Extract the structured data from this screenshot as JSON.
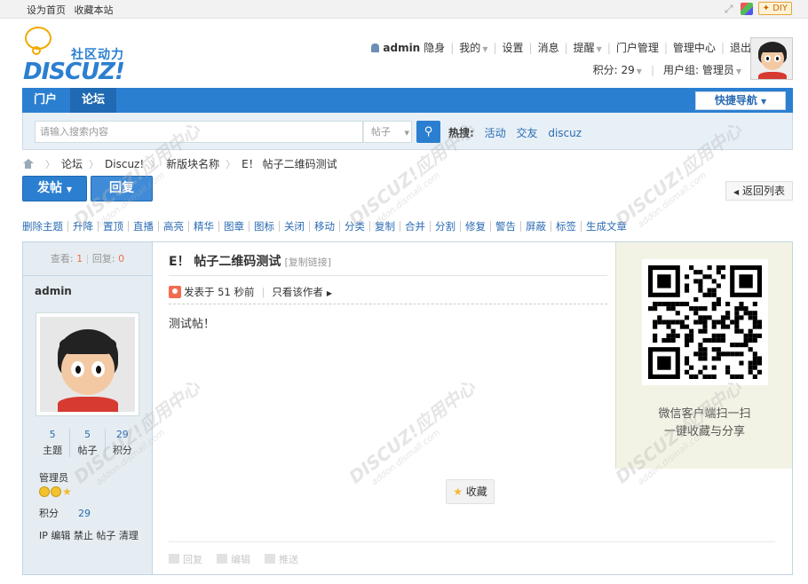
{
  "topbar": {
    "set_home": "设为首页",
    "bookmark": "收藏本站",
    "diy_label": "DIY"
  },
  "logo": {
    "slogan": "社区动力",
    "brand": "DISCUZ!"
  },
  "user": {
    "name": "admin",
    "invisible": "隐身",
    "my": "我的",
    "settings": "设置",
    "messages": "消息",
    "reminders": "提醒",
    "portal_admin": "门户管理",
    "admin_center": "管理中心",
    "logout": "退出",
    "credits": "积分: 29",
    "usergroup": "用户组: 管理员"
  },
  "nav": {
    "portal": "门户",
    "forum": "论坛",
    "quick_nav": "快捷导航"
  },
  "search": {
    "placeholder": "请输入搜索内容",
    "type": "帖子",
    "hot_label": "热搜:",
    "hot_words": [
      "活动",
      "交友",
      "discuz"
    ]
  },
  "breadcrumb": [
    "论坛",
    "Discuz!",
    "新版块名称",
    "E！ 帖子二维码测试"
  ],
  "actions": {
    "post": "发帖",
    "reply": "回复",
    "back_to_list": "返回列表"
  },
  "mod_actions": [
    "删除主题",
    "升降",
    "置顶",
    "直播",
    "高亮",
    "精华",
    "图章",
    "图标",
    "关闭",
    "移动",
    "分类",
    "复制",
    "合并",
    "分割",
    "修复",
    "警告",
    "屏蔽",
    "标签",
    "生成文章"
  ],
  "thread_stats": {
    "views_label": "查看:",
    "views": "1",
    "replies_label": "回复:",
    "replies": "0"
  },
  "author": {
    "name": "admin",
    "stats": [
      {
        "value": "5",
        "label": "主题"
      },
      {
        "value": "5",
        "label": "帖子"
      },
      {
        "value": "29",
        "label": "积分"
      }
    ],
    "group": "管理员",
    "credit_label": "积分",
    "credit_value": "29",
    "admin_links": "IP 编辑 禁止 帖子 清理"
  },
  "post": {
    "title": "E！ 帖子二维码测试",
    "copy_link": "[复制链接]",
    "posted": "发表于 51 秒前",
    "only_author": "只看该作者",
    "content": "测试帖！",
    "favorite": "收藏",
    "bottom_actions": [
      "回复",
      "编辑",
      "推送"
    ]
  },
  "qr": {
    "caption_line1": "微信客户端扫一扫",
    "caption_line2": "一键收藏与分享"
  }
}
